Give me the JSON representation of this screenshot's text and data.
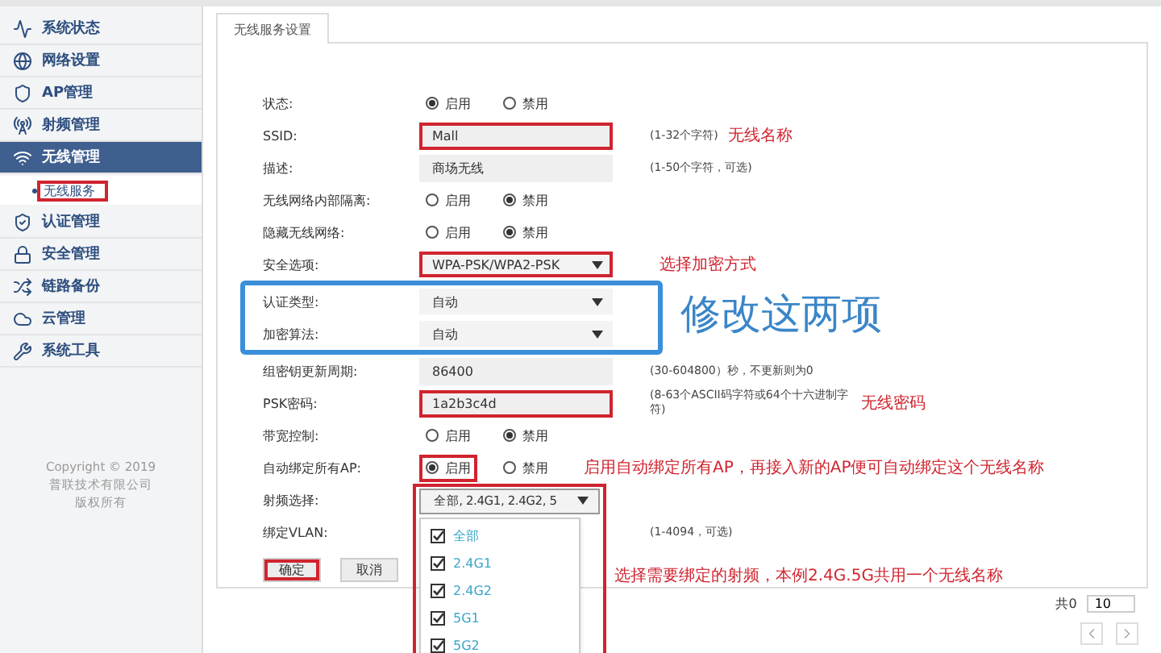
{
  "sidebar": {
    "items": [
      {
        "label": "系统状态",
        "selected": false
      },
      {
        "label": "网络设置",
        "selected": false
      },
      {
        "label": "AP管理",
        "selected": false
      },
      {
        "label": "射频管理",
        "selected": false
      },
      {
        "label": "无线管理",
        "selected": true,
        "children": [
          {
            "label": "无线服务",
            "selected": true,
            "annotated": true
          }
        ]
      },
      {
        "label": "认证管理",
        "selected": false
      },
      {
        "label": "安全管理",
        "selected": false
      },
      {
        "label": "链路备份",
        "selected": false
      },
      {
        "label": "云管理",
        "selected": false
      },
      {
        "label": "系统工具",
        "selected": false
      }
    ],
    "copyright": [
      "Copyright © 2019",
      "普联技术有限公司",
      "版权所有"
    ]
  },
  "tabs": [
    {
      "label": "无线服务设置",
      "selected": true
    }
  ],
  "form": {
    "rows": [
      {
        "kind": "radio",
        "label": "状态:",
        "options": [
          {
            "label": "启用",
            "selected": true
          },
          {
            "label": "禁用",
            "selected": false
          }
        ]
      },
      {
        "kind": "text",
        "label": "SSID:",
        "value": "Mall",
        "hint": "(1-32个字符)",
        "annotated": true,
        "note": "无线名称"
      },
      {
        "kind": "text",
        "label": "描述:",
        "value": "商场无线",
        "hint": "(1-50个字符，可选)"
      },
      {
        "kind": "radio",
        "label": "无线网络内部隔离:",
        "options": [
          {
            "label": "启用",
            "selected": false
          },
          {
            "label": "禁用",
            "selected": true
          }
        ]
      },
      {
        "kind": "radio",
        "label": "隐藏无线网络:",
        "options": [
          {
            "label": "启用",
            "selected": false
          },
          {
            "label": "禁用",
            "selected": true
          }
        ]
      },
      {
        "kind": "select",
        "label": "安全选项:",
        "value": "WPA-PSK/WPA2-PSK",
        "annotated": true,
        "note": "选择加密方式"
      },
      {
        "kind": "group",
        "note": "修改这两项",
        "rows": [
          {
            "kind": "select",
            "label": "认证类型:",
            "value": "自动"
          },
          {
            "kind": "select",
            "label": "加密算法:",
            "value": "自动"
          }
        ]
      },
      {
        "kind": "text",
        "label": "组密钥更新周期:",
        "value": "86400",
        "hint": "(30-604800）秒，不更新则为0"
      },
      {
        "kind": "text",
        "label": "PSK密码:",
        "value": "1a2b3c4d",
        "hint": "(8-63个ASCII码字符或64个十六进制字符)",
        "annotated": true,
        "note": "无线密码"
      },
      {
        "kind": "radio",
        "label": "带宽控制:",
        "options": [
          {
            "label": "启用",
            "selected": false
          },
          {
            "label": "禁用",
            "selected": true
          }
        ]
      },
      {
        "kind": "radio",
        "label": "自动绑定所有AP:",
        "options": [
          {
            "label": "启用",
            "selected": true,
            "annotated": true
          },
          {
            "label": "禁用",
            "selected": false
          }
        ],
        "note": "启用自动绑定所有AP，再接入新的AP便可自动绑定这个无线名称"
      },
      {
        "kind": "multiselect",
        "label": "射频选择:",
        "value": "全部, 2.4G1, 2.4G2, 5",
        "annotated": true,
        "expanded": true,
        "note": "选择需要绑定的射频，本例2.4G.5G共用一个无线名称",
        "options": [
          {
            "label": "全部",
            "checked": true
          },
          {
            "label": "2.4G1",
            "checked": true
          },
          {
            "label": "2.4G2",
            "checked": true
          },
          {
            "label": "5G1",
            "checked": true
          },
          {
            "label": "5G2",
            "checked": true
          }
        ]
      },
      {
        "kind": "text",
        "label": "绑定VLAN:",
        "hint": "(1-4094，可选)"
      }
    ],
    "buttons": [
      {
        "label": "确定",
        "annotated": true
      },
      {
        "label": "取消",
        "annotated": false
      }
    ]
  },
  "pagination": {
    "summary": "共0",
    "page_size": "10"
  }
}
